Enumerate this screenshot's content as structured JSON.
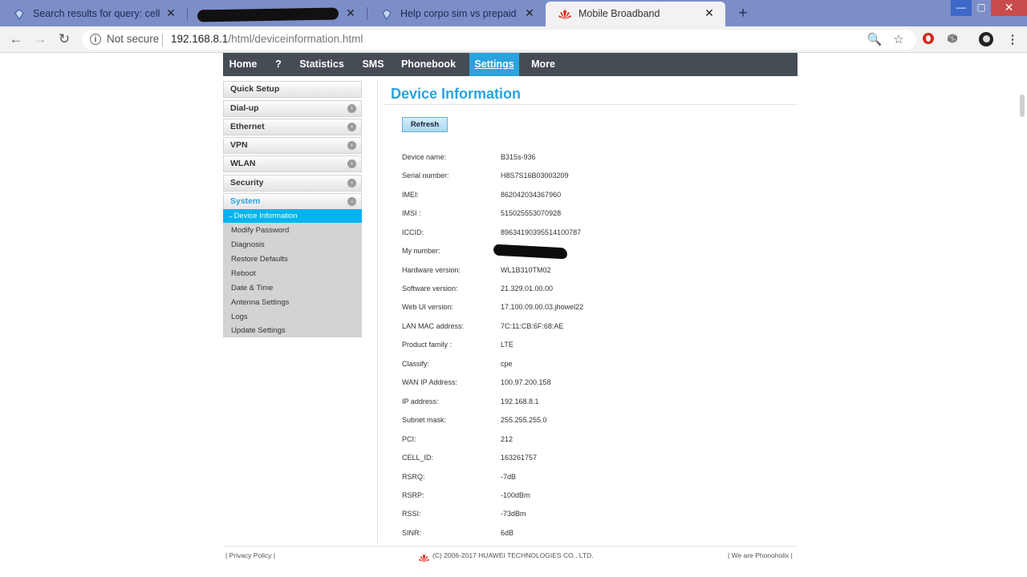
{
  "browser": {
    "tabs": [
      {
        "title": "Search results for query: cell id",
        "close": "✕",
        "icon": "tab-favicon-icon"
      },
      {
        "title": "",
        "close": "✕",
        "icon": "youtube-icon"
      },
      {
        "title": "Help corpo sim vs prepaid sim |",
        "close": "✕",
        "icon": "tab-favicon-icon"
      },
      {
        "title": "Mobile Broadband",
        "close": "✕",
        "icon": "huawei-icon"
      }
    ],
    "new_tab": "+",
    "window": {
      "minimize": "—",
      "maximize": "▢",
      "close": "✕"
    },
    "nav": {
      "back": "←",
      "forward": "→",
      "reload": "↻"
    },
    "security_label": "Not secure",
    "url_host": "192.168.8.1",
    "url_path": "/html/deviceinformation.html",
    "icons": {
      "zoom": "🔍",
      "star": "☆"
    }
  },
  "topnav": [
    {
      "label": "Home"
    },
    {
      "label": "?"
    },
    {
      "label": "Statistics"
    },
    {
      "label": "SMS"
    },
    {
      "label": "Phonebook"
    },
    {
      "label": "Settings"
    },
    {
      "label": "More"
    }
  ],
  "sidebar": {
    "sections": [
      {
        "label": "Quick Setup"
      },
      {
        "label": "Dial-up"
      },
      {
        "label": "Ethernet"
      },
      {
        "label": "VPN"
      },
      {
        "label": "WLAN"
      },
      {
        "label": "Security"
      },
      {
        "label": "System"
      }
    ],
    "arrow": "›",
    "system_items": [
      {
        "label": "→Device Information"
      },
      {
        "label": "Modify Password"
      },
      {
        "label": "Diagnosis"
      },
      {
        "label": "Restore Defaults"
      },
      {
        "label": "Reboot"
      },
      {
        "label": "Date & Time"
      },
      {
        "label": "Antenna Settings"
      },
      {
        "label": "Logs"
      },
      {
        "label": "Update Settings"
      }
    ]
  },
  "content": {
    "title": "Device Information",
    "refresh_label": "Refresh",
    "fields": [
      {
        "label": "Device name:",
        "value": "B315s-936"
      },
      {
        "label": "Serial number:",
        "value": "H8S7S16B03003209"
      },
      {
        "label": "IMEI:",
        "value": "862042034367960"
      },
      {
        "label": "IMSI :",
        "value": "515025553070928"
      },
      {
        "label": "ICCID:",
        "value": "89634190395514100787"
      },
      {
        "label": "My number:",
        "value": ""
      },
      {
        "label": "Hardware version:",
        "value": "WL1B310TM02"
      },
      {
        "label": "Software version:",
        "value": "21.329.01.00.00"
      },
      {
        "label": "Web UI version:",
        "value": "17.100.09.00.03.jhowel22"
      },
      {
        "label": "LAN MAC address:",
        "value": "7C:11:CB:6F:68:AE"
      },
      {
        "label": "Product family :",
        "value": "LTE"
      },
      {
        "label": "Classify:",
        "value": "cpe"
      },
      {
        "label": "WAN IP Address:",
        "value": "100.97.200.158"
      },
      {
        "label": "IP address:",
        "value": "192.168.8.1"
      },
      {
        "label": "Subnet mask:",
        "value": "255.255.255.0"
      },
      {
        "label": "PCI:",
        "value": "212"
      },
      {
        "label": "CELL_ID:",
        "value": "163261757"
      },
      {
        "label": "RSRQ:",
        "value": "-7dB"
      },
      {
        "label": "RSRP:",
        "value": "-100dBm"
      },
      {
        "label": "RSSI:",
        "value": "-73dBm"
      },
      {
        "label": "SINR:",
        "value": "6dB"
      }
    ]
  },
  "footer": {
    "privacy": "| Privacy Policy |",
    "copyright": "(C) 2006-2017 HUAWEI TECHNOLOGIES CO., LTD.",
    "right": "| We are Phonoholix |"
  },
  "colors": {
    "accent": "#2aa3de",
    "nav_bg": "#464c53",
    "active_submenu": "#00b4f0",
    "tabstrip": "#7b8ec8",
    "huawei_red": "#e1251b"
  }
}
